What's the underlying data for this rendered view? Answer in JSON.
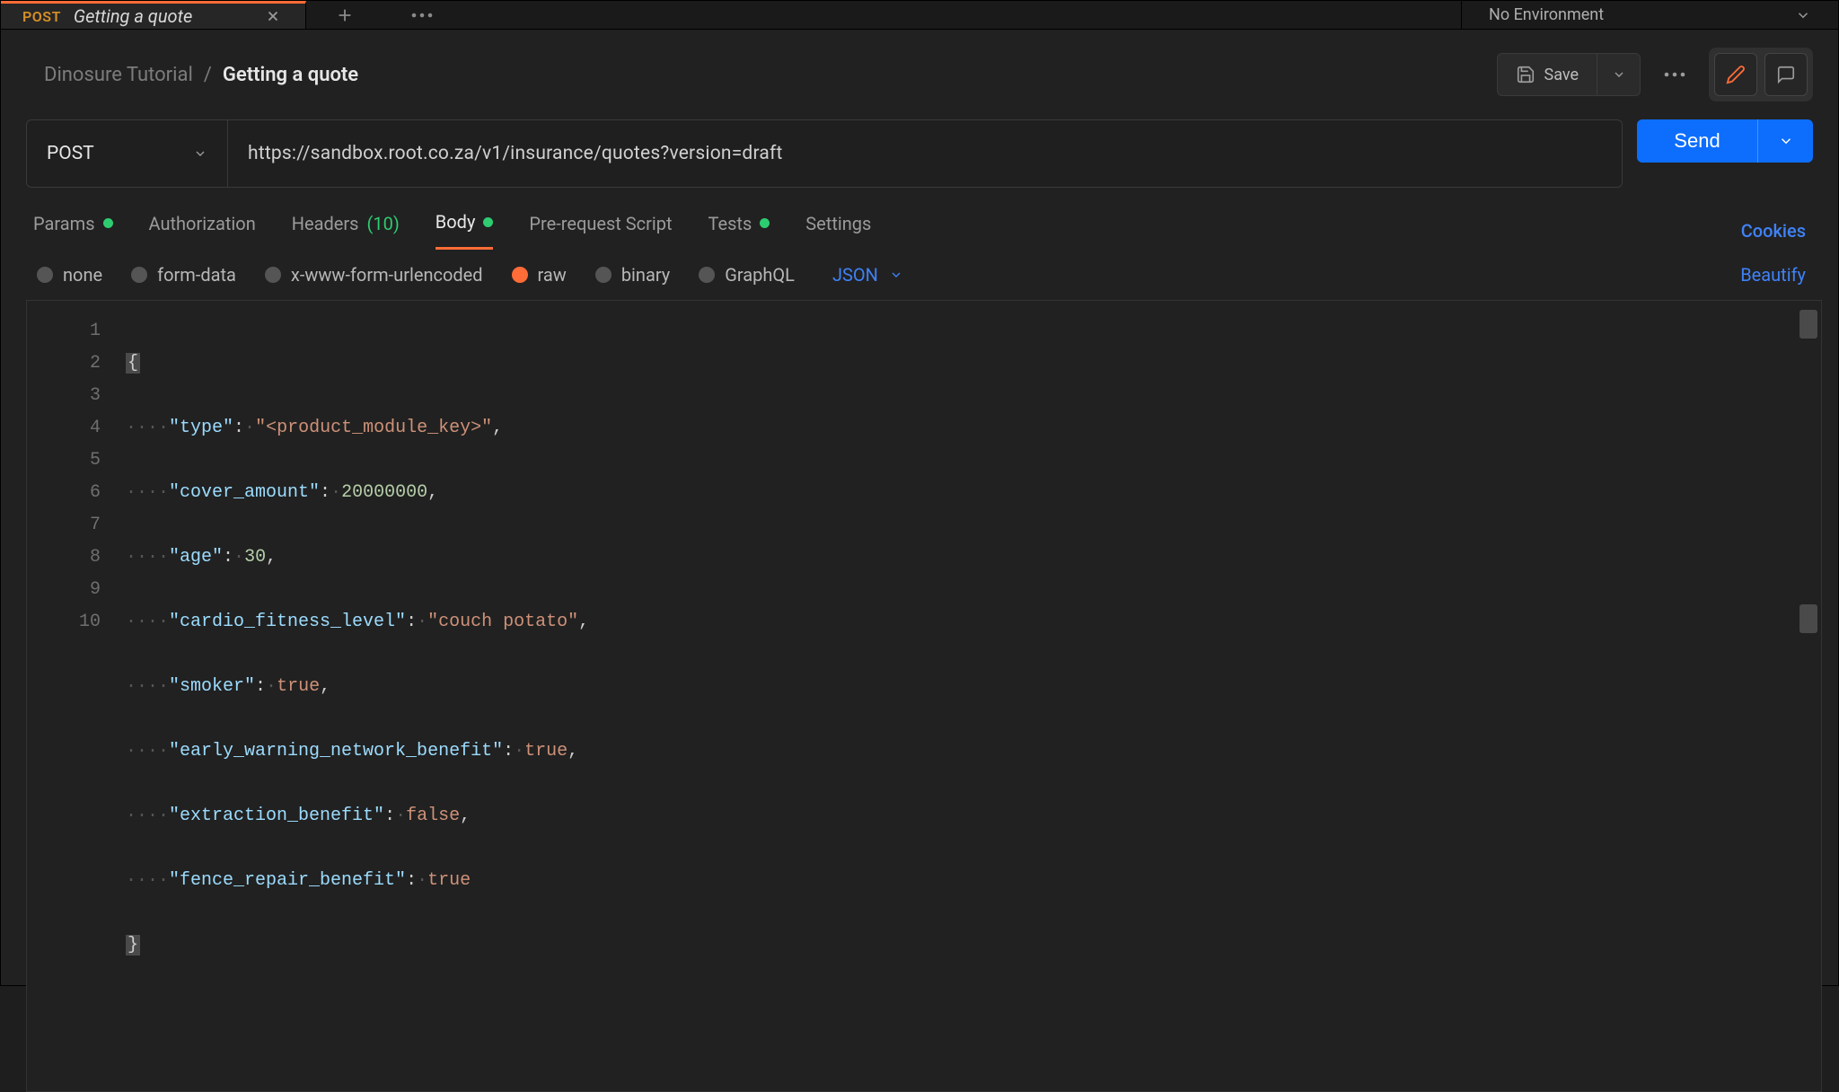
{
  "tab": {
    "method": "POST",
    "title": "Getting a quote"
  },
  "environment": {
    "label": "No Environment"
  },
  "breadcrumb": {
    "collection": "Dinosure Tutorial",
    "sep": "/",
    "request": "Getting a quote"
  },
  "actions": {
    "save_label": "Save"
  },
  "request": {
    "method": "POST",
    "url": "https://sandbox.root.co.za/v1/insurance/quotes?version=draft",
    "send_label": "Send"
  },
  "subtabs": {
    "params": "Params",
    "authorization": "Authorization",
    "headers": "Headers",
    "headers_count": "(10)",
    "body": "Body",
    "prerequest": "Pre-request Script",
    "tests": "Tests",
    "settings": "Settings",
    "cookies": "Cookies"
  },
  "body_types": {
    "none": "none",
    "formdata": "form-data",
    "xwww": "x-www-form-urlencoded",
    "raw": "raw",
    "binary": "binary",
    "graphql": "GraphQL",
    "lang": "JSON",
    "beautify": "Beautify"
  },
  "editor": {
    "lines": [
      "1",
      "2",
      "3",
      "4",
      "5",
      "6",
      "7",
      "8",
      "9",
      "10"
    ],
    "json_body": {
      "type": "<product_module_key>",
      "cover_amount": 20000000,
      "age": 30,
      "cardio_fitness_level": "couch potato",
      "smoker": true,
      "early_warning_network_benefit": true,
      "extraction_benefit": false,
      "fence_repair_benefit": true
    },
    "open_brace": "{",
    "close_brace": "}",
    "indent_dots": "····",
    "keys": {
      "type": "\"type\"",
      "cover_amount": "\"cover_amount\"",
      "age": "\"age\"",
      "cardio": "\"cardio_fitness_level\"",
      "smoker": "\"smoker\"",
      "early": "\"early_warning_network_benefit\"",
      "extraction": "\"extraction_benefit\"",
      "fence": "\"fence_repair_benefit\""
    },
    "vals": {
      "type": "\"<product_module_key>\"",
      "cover_amount": "20000000",
      "age": "30",
      "cardio": "\"couch potato\"",
      "smoker": "true",
      "early": "true",
      "extraction": "false",
      "fence": "true"
    },
    "colon": ":",
    "comma": ",",
    "mid_dot": "·"
  }
}
